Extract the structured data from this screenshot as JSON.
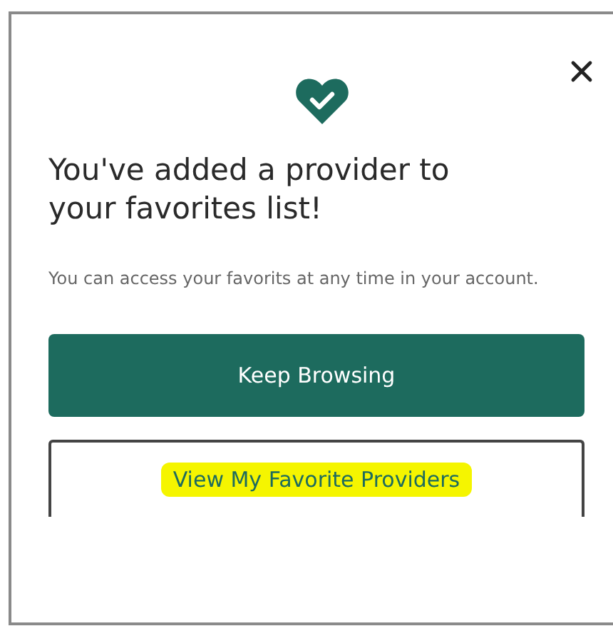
{
  "dialog": {
    "title": "You've added a provider to your favorites list!",
    "message": "You can access your favorits at any time in your account.",
    "buttons": [
      {
        "label": "Keep Browsing",
        "kind": "primary",
        "highlighted": false
      },
      {
        "label": "View My Favorite Providers",
        "kind": "secondary",
        "highlighted": true
      }
    ]
  }
}
